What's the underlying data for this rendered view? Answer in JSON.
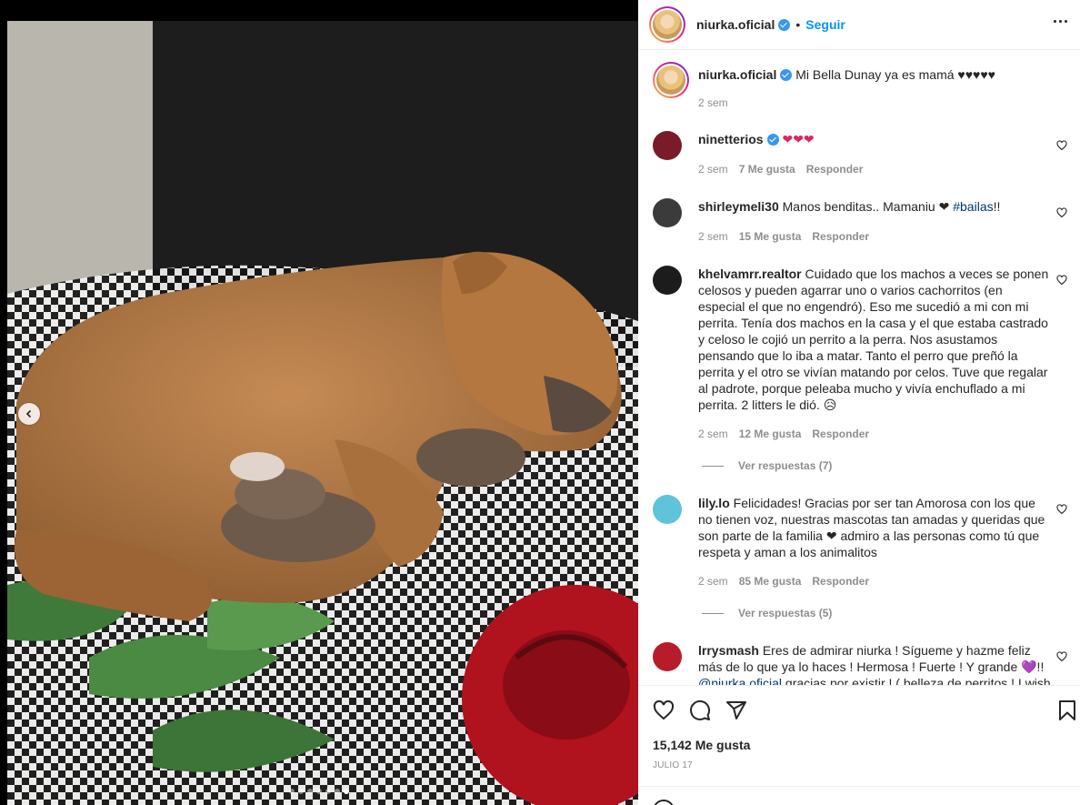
{
  "post": {
    "author": "niurka.oficial",
    "follow_label": "Seguir",
    "separator": "•",
    "caption": "Mi Bella Dunay ya es mamá ♥♥♥♥♥",
    "caption_time": "2 sem",
    "likes": "15,142 Me gusta",
    "date": "JULIO 17"
  },
  "carousel": {
    "slides": 7,
    "active_index": 6
  },
  "comments": [
    {
      "user": "ninetterios",
      "verified": true,
      "text": "❤❤❤",
      "time": "2 sem",
      "likes": "7 Me gusta",
      "reply": "Responder",
      "avatar_color": "#7a1b2a"
    },
    {
      "user": "shirleymeli30",
      "text": "Manos benditas.. Mamaniu ❤",
      "hashtag": "#bailas",
      "after": "!!",
      "time": "2 sem",
      "likes": "15 Me gusta",
      "reply": "Responder",
      "avatar_color": "#3b3b3b"
    },
    {
      "user": "khelvamrr.realtor",
      "text": "Cuidado que los machos a veces se ponen celosos y pueden agarrar uno o varios cachorritos (en especial el que no engendró). Eso me sucedió a mi con mi perrita. Tenía dos machos en la casa y el que estaba castrado y celoso le cojió un perrito a la perra. Nos asustamos pensando que lo iba a matar. Tanto el perro que preñó la perrita y el otro se vivían matando por celos. Tuve que regalar al padrote, porque peleaba mucho y vivía enchuflado a mi perrita. 2 litters le dió. 😥",
      "time": "2 sem",
      "likes": "12 Me gusta",
      "reply": "Responder",
      "view_replies": "Ver respuestas (7)",
      "avatar_color": "#1c1c1c"
    },
    {
      "user": "lily.lo",
      "text": "Felicidades! Gracias por ser tan Amorosa con los que no tienen voz, nuestras mascotas tan amadas y queridas que son parte de la familia ❤ admiro a las personas como tú que respeta y aman a los animalitos",
      "time": "2 sem",
      "likes": "85 Me gusta",
      "reply": "Responder",
      "view_replies": "Ver respuestas (5)",
      "avatar_color": "#5fc3d9"
    },
    {
      "user": "lrrysmash",
      "text": "Eres de admirar niurka ! Sígueme y hazme feliz más de lo que ya lo haces ! Hermosa ! Fuerte ! Y grande 💜!!",
      "mention": "@niurka.oficial",
      "after": "gracias por existir ! ( belleza de perritos ! I wish !",
      "avatar_color": "#b81c2a"
    }
  ],
  "colors": {
    "accent": "#0095f6",
    "verified": "#3897f0",
    "muted": "#8e8e8e"
  },
  "icons": [
    "chevron-left-icon",
    "more-options-icon",
    "heart-icon",
    "comment-icon",
    "share-icon",
    "bookmark-icon",
    "emoji-icon",
    "verified-icon"
  ]
}
